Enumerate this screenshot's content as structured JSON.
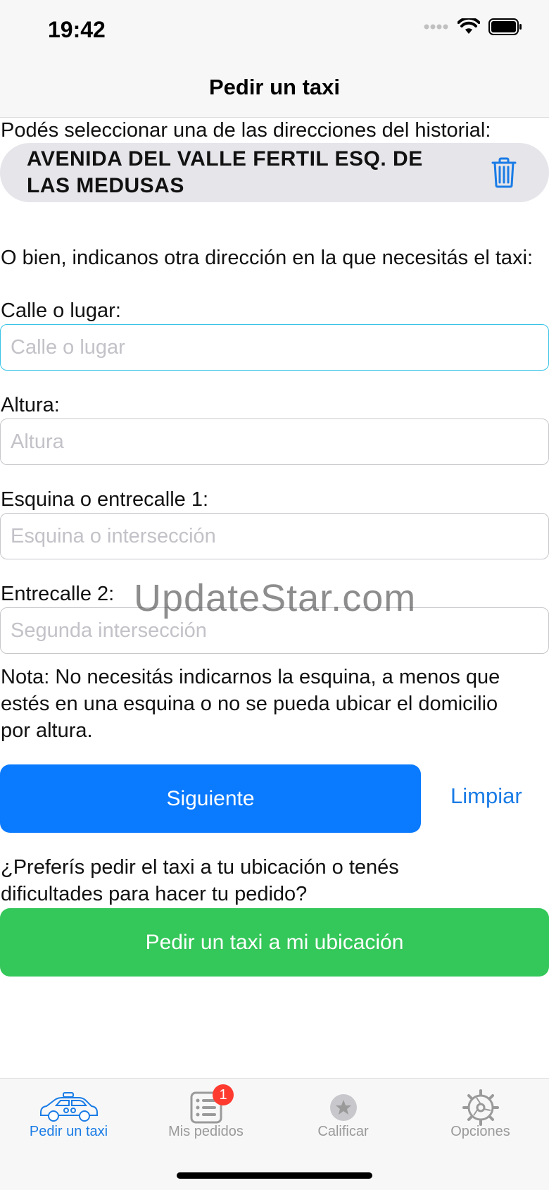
{
  "status_bar": {
    "time": "19:42"
  },
  "nav": {
    "title": "Pedir un taxi"
  },
  "history": {
    "prompt": "Podés seleccionar una de las direcciones del historial:",
    "items": [
      {
        "address": "AVENIDA DEL VALLE FERTIL ESQ. DE LAS MEDUSAS"
      }
    ]
  },
  "form": {
    "intro": "O bien, indicanos otra dirección en la que necesitás el taxi:",
    "street": {
      "label": "Calle o lugar:",
      "placeholder": "Calle o lugar",
      "value": ""
    },
    "number": {
      "label": "Altura:",
      "placeholder": "Altura",
      "value": ""
    },
    "corner1": {
      "label": "Esquina o entrecalle 1:",
      "placeholder": "Esquina o intersección",
      "value": ""
    },
    "corner2": {
      "label": "Entrecalle 2:",
      "placeholder": "Segunda intersección",
      "value": ""
    },
    "note": "Nota: No necesitás indicarnos la esquina, a menos que estés en una esquina o no se pueda ubicar el domicilio por altura."
  },
  "actions": {
    "next_label": "Siguiente",
    "clear_label": "Limpiar",
    "location_prompt": "¿Preferís pedir el taxi a tu ubicación o tenés dificultades para hacer tu pedido?",
    "location_button": "Pedir un taxi a mi ubicación"
  },
  "watermark": "UpdateStar.com",
  "tabbar": {
    "tabs": [
      {
        "label": "Pedir un taxi",
        "icon": "taxi-icon",
        "active": true
      },
      {
        "label": "Mis pedidos",
        "icon": "list-icon",
        "badge": "1"
      },
      {
        "label": "Calificar",
        "icon": "star-icon"
      },
      {
        "label": "Opciones",
        "icon": "gear-icon"
      }
    ]
  },
  "colors": {
    "primary": "#0a7aff",
    "success": "#34c759",
    "link": "#1a7ce6",
    "badge": "#ff3b30",
    "history_bg": "#e5e5ea",
    "focus_border": "#36c3e6"
  }
}
